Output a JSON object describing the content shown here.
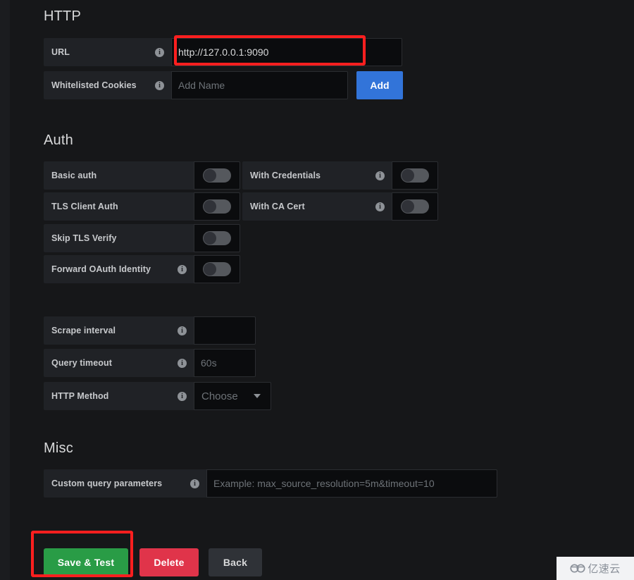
{
  "sections": {
    "http": {
      "title": "HTTP"
    },
    "auth": {
      "title": "Auth"
    },
    "misc": {
      "title": "Misc"
    }
  },
  "http": {
    "url": {
      "label": "URL",
      "value": "http://127.0.0.1:9090",
      "info_glyph": "i"
    },
    "cookies": {
      "label": "Whitelisted Cookies",
      "placeholder": "Add Name",
      "value": "",
      "info_glyph": "i",
      "add_label": "Add"
    }
  },
  "auth": {
    "rows": [
      {
        "label": "Basic auth",
        "has_info": false,
        "state": "off"
      },
      {
        "label": "With Credentials",
        "has_info": true,
        "state": "off"
      },
      {
        "label": "TLS Client Auth",
        "has_info": false,
        "state": "off"
      },
      {
        "label": "With CA Cert",
        "has_info": true,
        "state": "off"
      },
      {
        "label": "Skip TLS Verify",
        "has_info": false,
        "state": "off"
      },
      {
        "label": "Forward OAuth Identity",
        "has_info": true,
        "state": "off"
      }
    ]
  },
  "query": {
    "scrape_interval": {
      "label": "Scrape interval",
      "value": "",
      "placeholder": "",
      "info_glyph": "i"
    },
    "query_timeout": {
      "label": "Query timeout",
      "value": "",
      "placeholder": "60s",
      "info_glyph": "i"
    },
    "http_method": {
      "label": "HTTP Method",
      "value": "Choose",
      "info_glyph": "i"
    }
  },
  "misc": {
    "custom_params": {
      "label": "Custom query parameters",
      "placeholder": "Example: max_source_resolution=5m&timeout=10",
      "value": "",
      "info_glyph": "i"
    }
  },
  "actions": {
    "save": "Save & Test",
    "delete": "Delete",
    "back": "Back"
  },
  "annotations": {
    "accent_color": "#ff1f1f",
    "url_highlight": true,
    "save_highlight": true
  },
  "watermark": {
    "text": "亿速云"
  },
  "colors": {
    "page_bg": "#161719",
    "label_bg": "#202226",
    "input_bg": "#0b0c0e",
    "primary": "#3274d9",
    "success": "#299c46",
    "danger": "#e0344a",
    "annotation": "#ff1f1f"
  }
}
